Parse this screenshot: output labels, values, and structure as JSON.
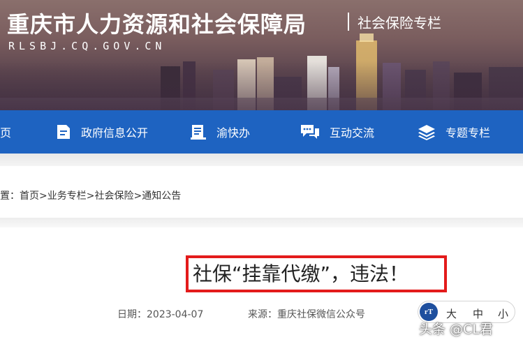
{
  "header": {
    "site_title": "重庆市人力资源和社会保障局",
    "site_domain": "RLSBJ.CQ.GOV.CN",
    "section_name": "社会保险专栏"
  },
  "nav": {
    "items": [
      {
        "label": "页",
        "icon": "home-icon"
      },
      {
        "label": "政府信息公开",
        "icon": "document-icon"
      },
      {
        "label": "渝快办",
        "icon": "service-icon"
      },
      {
        "label": "互动交流",
        "icon": "chat-icon"
      },
      {
        "label": "专题专栏",
        "icon": "layers-icon"
      }
    ]
  },
  "breadcrumb": {
    "prefix": "置：",
    "items": [
      "首页",
      "业务专栏",
      "社会保险",
      "通知公告"
    ],
    "separator": ">"
  },
  "article": {
    "title": "社保“挂靠代缴”，违法！",
    "date_label": "日期：2023-04-07",
    "source_label": "来源：重庆社保微信公众号"
  },
  "font_size_control": {
    "icon_text": "rT",
    "large": "大",
    "medium": "中",
    "small": "小"
  },
  "watermark": "头条 @CL君",
  "colors": {
    "nav_blue": "#1e63c1",
    "highlight_red": "#e31b1b"
  }
}
